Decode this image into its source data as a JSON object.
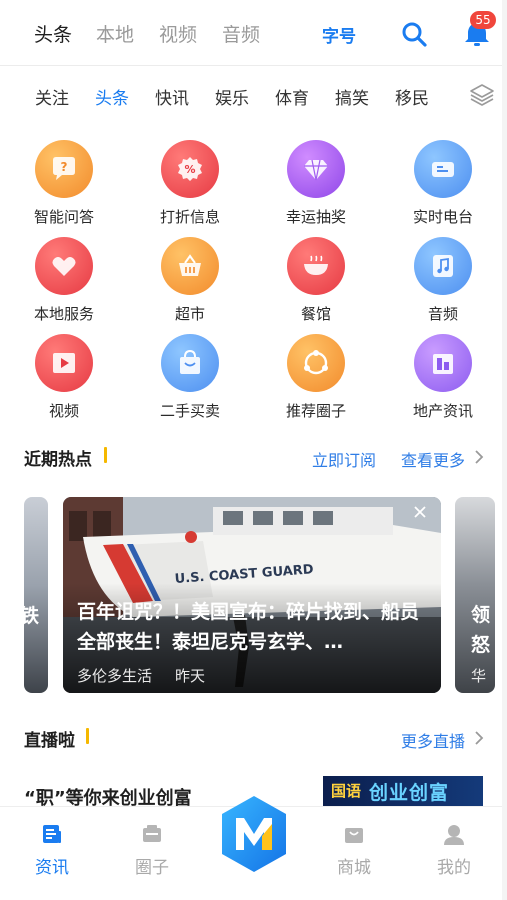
{
  "top_tabs": [
    {
      "label": "头条",
      "active": true
    },
    {
      "label": "本地",
      "active": false
    },
    {
      "label": "视频",
      "active": false
    },
    {
      "label": "音频",
      "active": false
    }
  ],
  "font_toggle_label": "字号",
  "notification_count": "55",
  "channels": [
    {
      "label": "关注",
      "active": false
    },
    {
      "label": "头条",
      "active": true
    },
    {
      "label": "快讯",
      "active": false
    },
    {
      "label": "娱乐",
      "active": false
    },
    {
      "label": "体育",
      "active": false
    },
    {
      "label": "搞笑",
      "active": false
    },
    {
      "label": "移民",
      "active": false
    }
  ],
  "grid": [
    {
      "label": "智能问答",
      "icon": "question-bubble-icon",
      "color": "orange"
    },
    {
      "label": "打折信息",
      "icon": "discount-tag-icon",
      "color": "red"
    },
    {
      "label": "幸运抽奖",
      "icon": "diamond-icon",
      "color": "purple"
    },
    {
      "label": "实时电台",
      "icon": "radio-icon",
      "color": "blue"
    },
    {
      "label": "本地服务",
      "icon": "heart-icon",
      "color": "red"
    },
    {
      "label": "超市",
      "icon": "basket-icon",
      "color": "orange"
    },
    {
      "label": "餐馆",
      "icon": "bowl-icon",
      "color": "red"
    },
    {
      "label": "音频",
      "icon": "music-icon",
      "color": "blue"
    },
    {
      "label": "视频",
      "icon": "film-icon",
      "color": "red"
    },
    {
      "label": "二手买卖",
      "icon": "shopping-bag-icon",
      "color": "blue"
    },
    {
      "label": "推荐圈子",
      "icon": "circle-group-icon",
      "color": "orange"
    },
    {
      "label": "地产资讯",
      "icon": "building-icon",
      "color": "violet"
    }
  ],
  "hot_section": {
    "title": "近期热点",
    "subscribe_label": "立即订阅",
    "more_label": "查看更多",
    "left_card_char": "铁",
    "right_card_chars": [
      "领",
      "怒",
      "华"
    ],
    "main_card": {
      "title": "百年诅咒？！美国宣布：碎片找到、船员全部丧生！泰坦尼克号玄学、…",
      "source": "多伦多生活",
      "time": "昨天",
      "photo_caption": "U.S. COAST GUARD"
    }
  },
  "live_section": {
    "title": "直播啦",
    "more_label": "更多直播",
    "headline": "“职”等你来创业创富",
    "thumb_tag": "国语",
    "thumb_text": "创业创富"
  },
  "bottom_nav": [
    {
      "label": "资讯",
      "icon": "news-icon",
      "active": true
    },
    {
      "label": "圈子",
      "icon": "community-icon",
      "active": false
    },
    {
      "label": "商城",
      "icon": "store-bag-icon",
      "active": false
    },
    {
      "label": "我的",
      "icon": "profile-icon",
      "active": false
    }
  ],
  "colors": {
    "accent": "#1a7cf0",
    "badge": "#f0463c",
    "section_mark": "#f5b800"
  }
}
